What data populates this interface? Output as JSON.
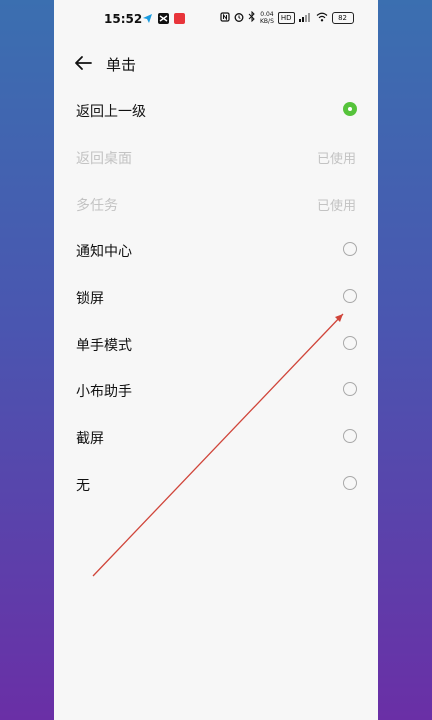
{
  "status_bar": {
    "time": "15:52",
    "net_speed_value": "0.04",
    "net_speed_unit": "KB/S",
    "hd_badge": "HD",
    "battery": "82"
  },
  "header": {
    "title": "单击"
  },
  "options": [
    {
      "label": "返回上一级",
      "state": "selected",
      "right": ""
    },
    {
      "label": "返回桌面",
      "state": "disabled",
      "right": "已使用"
    },
    {
      "label": "多任务",
      "state": "disabled",
      "right": "已使用"
    },
    {
      "label": "通知中心",
      "state": "unselected",
      "right": ""
    },
    {
      "label": "锁屏",
      "state": "unselected",
      "right": ""
    },
    {
      "label": "单手模式",
      "state": "unselected",
      "right": ""
    },
    {
      "label": "小布助手",
      "state": "unselected",
      "right": ""
    },
    {
      "label": "截屏",
      "state": "unselected",
      "right": ""
    },
    {
      "label": "无",
      "state": "unselected",
      "right": ""
    }
  ],
  "colors": {
    "accent_green": "#56c33b",
    "annotation_arrow": "#d0453a",
    "background_gradient_top": "#3b6fb0",
    "background_gradient_bottom": "#6a2fa6"
  }
}
